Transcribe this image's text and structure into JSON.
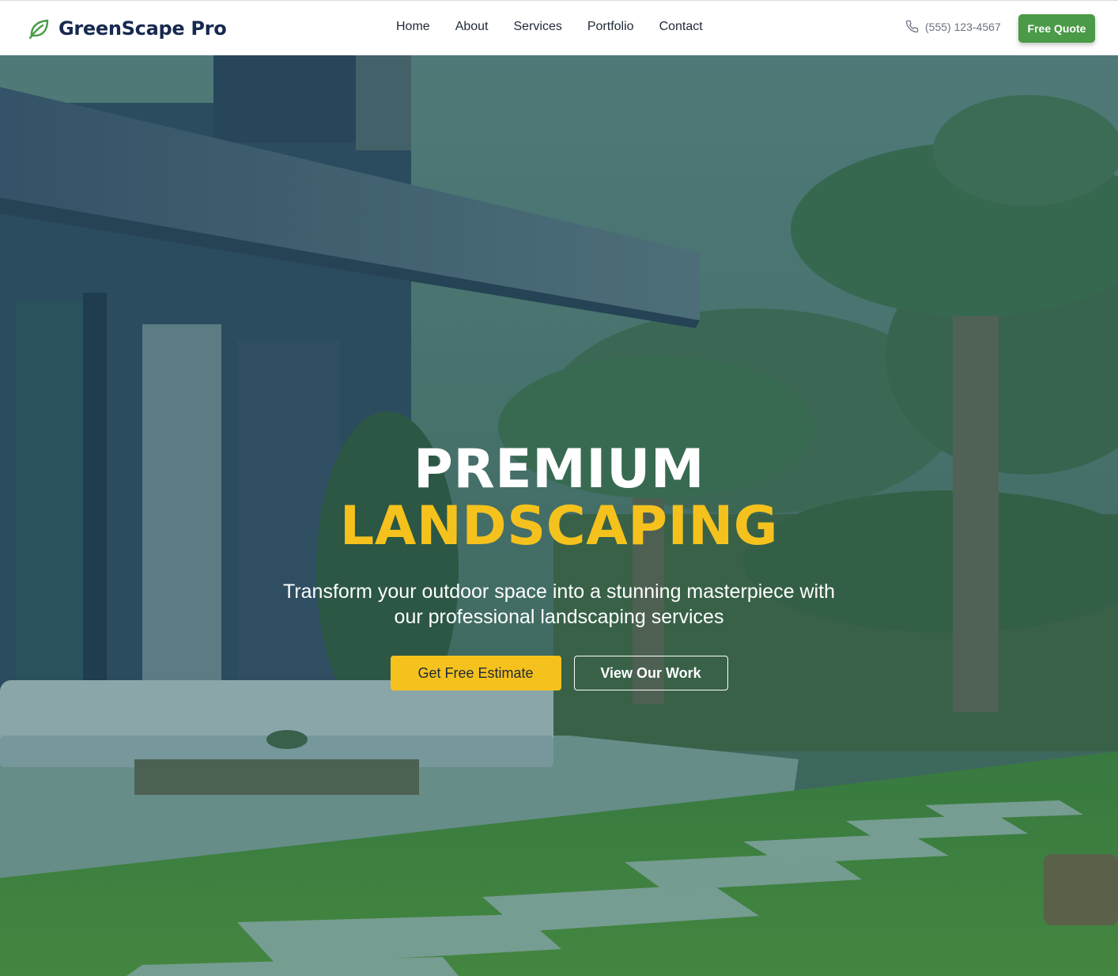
{
  "brand": {
    "name": "GreenScape Pro",
    "logo_icon": "leaf-icon"
  },
  "nav": {
    "links": [
      "Home",
      "About",
      "Services",
      "Portfolio",
      "Contact"
    ]
  },
  "contact": {
    "phone_icon": "phone-icon",
    "phone": "(555) 123-4567"
  },
  "header_cta": {
    "label": "Free Quote"
  },
  "hero": {
    "title_line1": "PREMIUM",
    "title_line2": "LANDSCAPING",
    "subtitle": "Transform your outdoor space into a stunning masterpiece with our professional landscaping services",
    "primary_cta": "Get Free Estimate",
    "secondary_cta": "View Our Work"
  },
  "colors": {
    "brand_green": "#4a9a47",
    "brand_navy": "#17294f",
    "accent_yellow": "#f5c21d",
    "overlay": "#2f5a4e"
  }
}
